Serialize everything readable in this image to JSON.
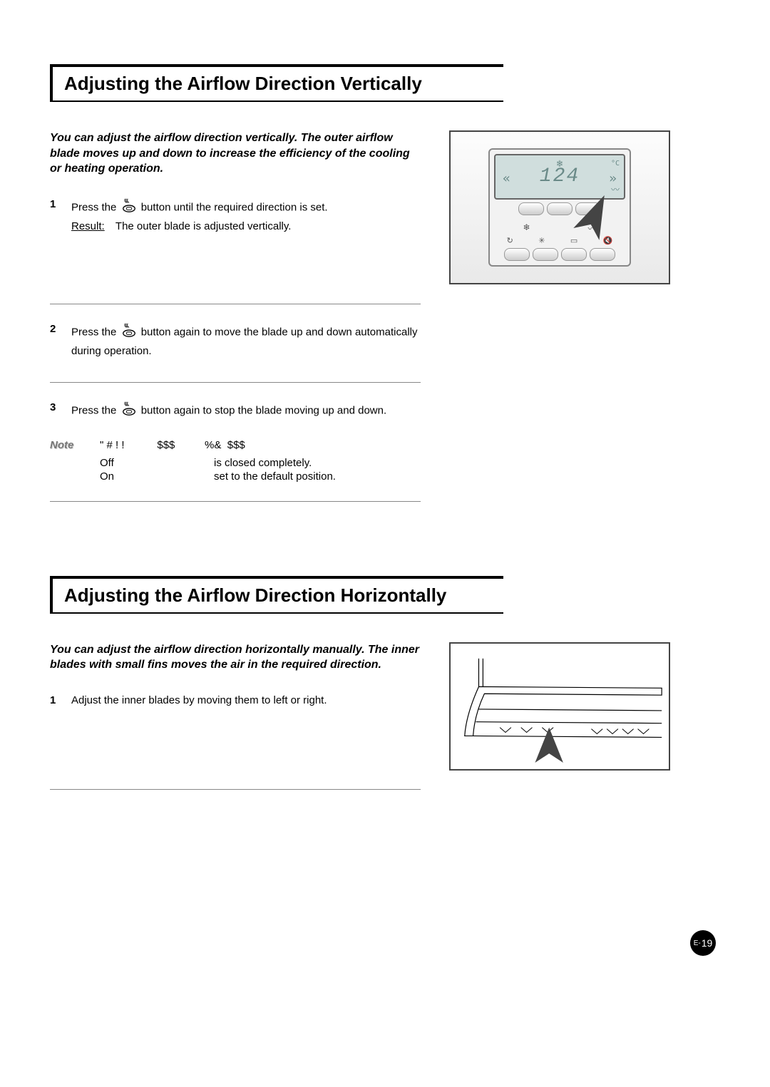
{
  "section1": {
    "title": "Adjusting the Airflow Direction Vertically",
    "intro": "You can adjust the airflow direction vertically. The outer airflow blade moves up and down to increase the efficiency of the cooling or heating operation.",
    "step1_a": "Press the",
    "step1_b": "button until the required direction is set.",
    "step1_result_label": "Result:",
    "step1_result_text": "The outer blade is adjusted vertically.",
    "step2_a": "Press the",
    "step2_b": "button again to move the blade up and down automatically during operation.",
    "step3_a": "Press the",
    "step3_b": "button again to stop the blade moving up and down.",
    "note_label": "Note",
    "note_header": "\" # ! !           $$$          %&  $$$",
    "note_off": "Off",
    "note_off_text": "is closed completely.",
    "note_on": "On",
    "note_on_text": "set to the default position."
  },
  "section2": {
    "title": "Adjusting the Airflow Direction Horizontally",
    "intro": "You can adjust the airflow direction horizontally manually. The inner blades with small fins moves the air in the required direction.",
    "step1": "Adjust the inner blades by moving them to left or right."
  },
  "remote": {
    "temp": "124",
    "unit": "°C"
  },
  "pageNumber": {
    "prefix": "E-",
    "num": "19"
  }
}
